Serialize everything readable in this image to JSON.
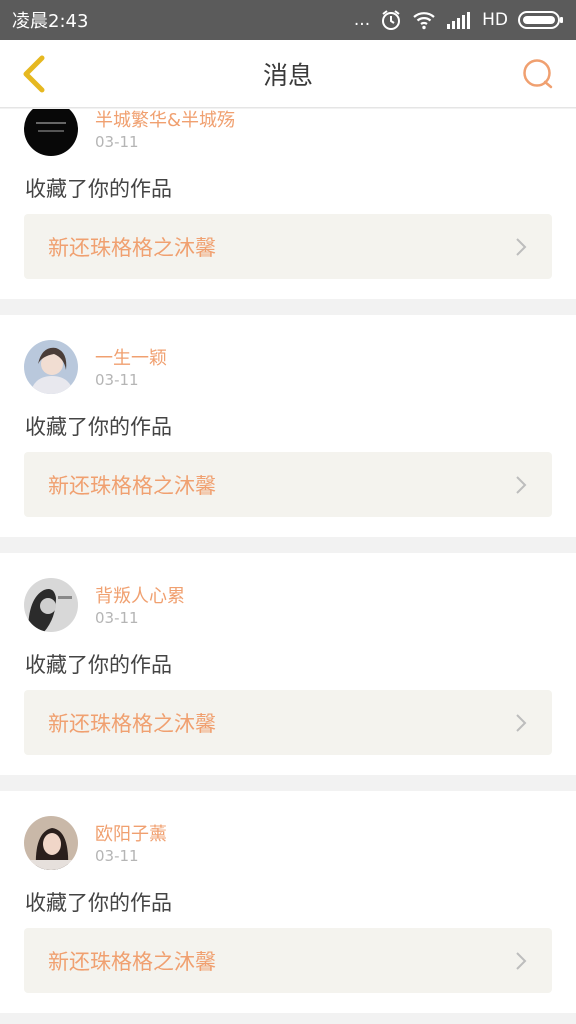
{
  "status_bar": {
    "time": "凌晨2:43",
    "more": "...",
    "network": "HD"
  },
  "header": {
    "title": "消息",
    "back_icon": "chevron-left-icon",
    "search_icon": "search-icon"
  },
  "colors": {
    "accent": "#f0a070",
    "back_arrow": "#e6b820",
    "link_bg": "#f4f3ee"
  },
  "messages": [
    {
      "user": "半城繁华&半城殇",
      "date": "03-11",
      "action": "收藏了你的作品",
      "work": "新还珠格格之沐馨"
    },
    {
      "user": "一生一颖",
      "date": "03-11",
      "action": "收藏了你的作品",
      "work": "新还珠格格之沐馨"
    },
    {
      "user": "背叛人心累",
      "date": "03-11",
      "action": "收藏了你的作品",
      "work": "新还珠格格之沐馨"
    },
    {
      "user": "欧阳子薰",
      "date": "03-11",
      "action": "收藏了你的作品",
      "work": "新还珠格格之沐馨"
    }
  ]
}
